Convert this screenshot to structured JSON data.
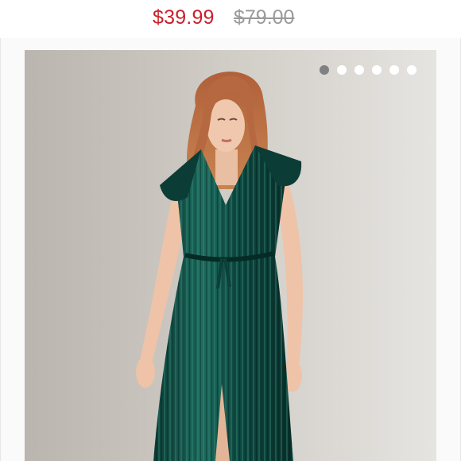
{
  "listing": {
    "sale_price": "$39.99",
    "original_price": "$79.00"
  },
  "gallery": {
    "total_images": 6,
    "active_index": 0,
    "image_subject": "model-wearing-green-pleated-dress"
  },
  "colors": {
    "sale_price": "#c9202b",
    "original_price": "#9a9a9a",
    "dot_active": "#7f8184",
    "dot_inactive": "#ffffff",
    "dress": "#0f4a41"
  }
}
